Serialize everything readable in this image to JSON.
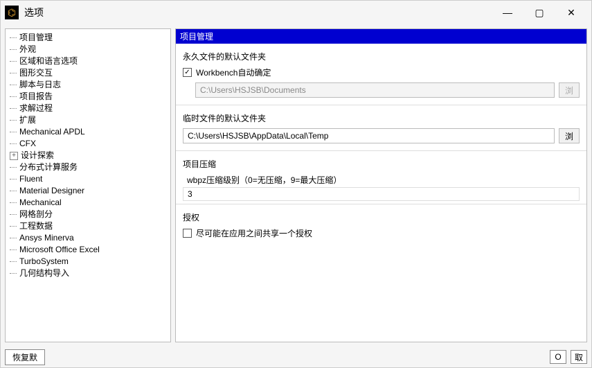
{
  "window": {
    "title": "选项"
  },
  "win_controls": {
    "min": "—",
    "max": "▢",
    "close": "✕"
  },
  "sidebar": {
    "items": [
      {
        "label": "项目管理",
        "expandable": false
      },
      {
        "label": "外观",
        "expandable": false
      },
      {
        "label": "区域和语言选项",
        "expandable": false
      },
      {
        "label": "图形交互",
        "expandable": false
      },
      {
        "label": "脚本与日志",
        "expandable": false
      },
      {
        "label": "项目报告",
        "expandable": false
      },
      {
        "label": "求解过程",
        "expandable": false
      },
      {
        "label": "扩展",
        "expandable": false
      },
      {
        "label": "Mechanical APDL",
        "expandable": false
      },
      {
        "label": "CFX",
        "expandable": false
      },
      {
        "label": "设计探索",
        "expandable": true
      },
      {
        "label": "分布式计算服务",
        "expandable": false
      },
      {
        "label": "Fluent",
        "expandable": false
      },
      {
        "label": "Material Designer",
        "expandable": false
      },
      {
        "label": "Mechanical",
        "expandable": false
      },
      {
        "label": "网格剖分",
        "expandable": false
      },
      {
        "label": "工程数据",
        "expandable": false
      },
      {
        "label": "Ansys Minerva",
        "expandable": false
      },
      {
        "label": "Microsoft Office Excel",
        "expandable": false
      },
      {
        "label": "TurboSystem",
        "expandable": false
      },
      {
        "label": "几何结构导入",
        "expandable": false
      }
    ]
  },
  "main": {
    "header": "项目管理",
    "perm_folder": {
      "title": "永久文件的默认文件夹",
      "checkbox_label": "Workbench自动确定",
      "checked": true,
      "path": "C:\\Users\\HSJSB\\Documents",
      "browse": "浏"
    },
    "temp_folder": {
      "title": "临时文件的默认文件夹",
      "path": "C:\\Users\\HSJSB\\AppData\\Local\\Temp",
      "browse": "浏"
    },
    "compress": {
      "title": "项目压缩",
      "label": "wbpz压缩级别（0=无压缩，9=最大压缩）",
      "value": "3"
    },
    "auth": {
      "title": "授权",
      "checkbox_label": "尽可能在应用之间共享一个授权",
      "checked": false
    }
  },
  "footer": {
    "restore": "恢复默",
    "ok": "O",
    "cancel": "取"
  }
}
